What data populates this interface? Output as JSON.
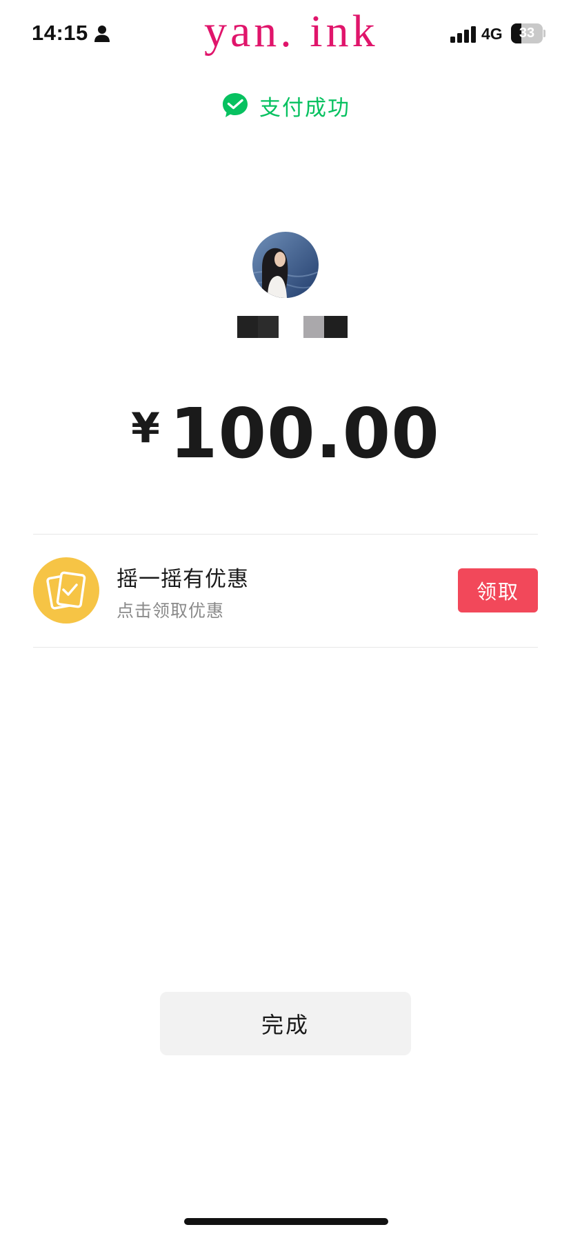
{
  "status_bar": {
    "time": "14:15",
    "network": "4G",
    "battery_level": "33",
    "battery_fraction": 0.33,
    "watermark": "yan. ink",
    "icons": [
      "person-icon",
      "signal-icon",
      "battery-icon"
    ]
  },
  "header": {
    "icon": "wechat-pay-icon",
    "title": "支付成功",
    "accent_color": "#07c160"
  },
  "payee": {
    "avatar": "avatar"
  },
  "payment": {
    "currency_symbol": "¥",
    "amount": "100.00"
  },
  "promo": {
    "icon": "coupon-icon",
    "icon_color": "#f6c445",
    "title": "摇一摇有优惠",
    "subtitle": "点击领取优惠",
    "claim_label": "领取",
    "claim_color": "#f2485a"
  },
  "footer": {
    "done_label": "完成"
  }
}
